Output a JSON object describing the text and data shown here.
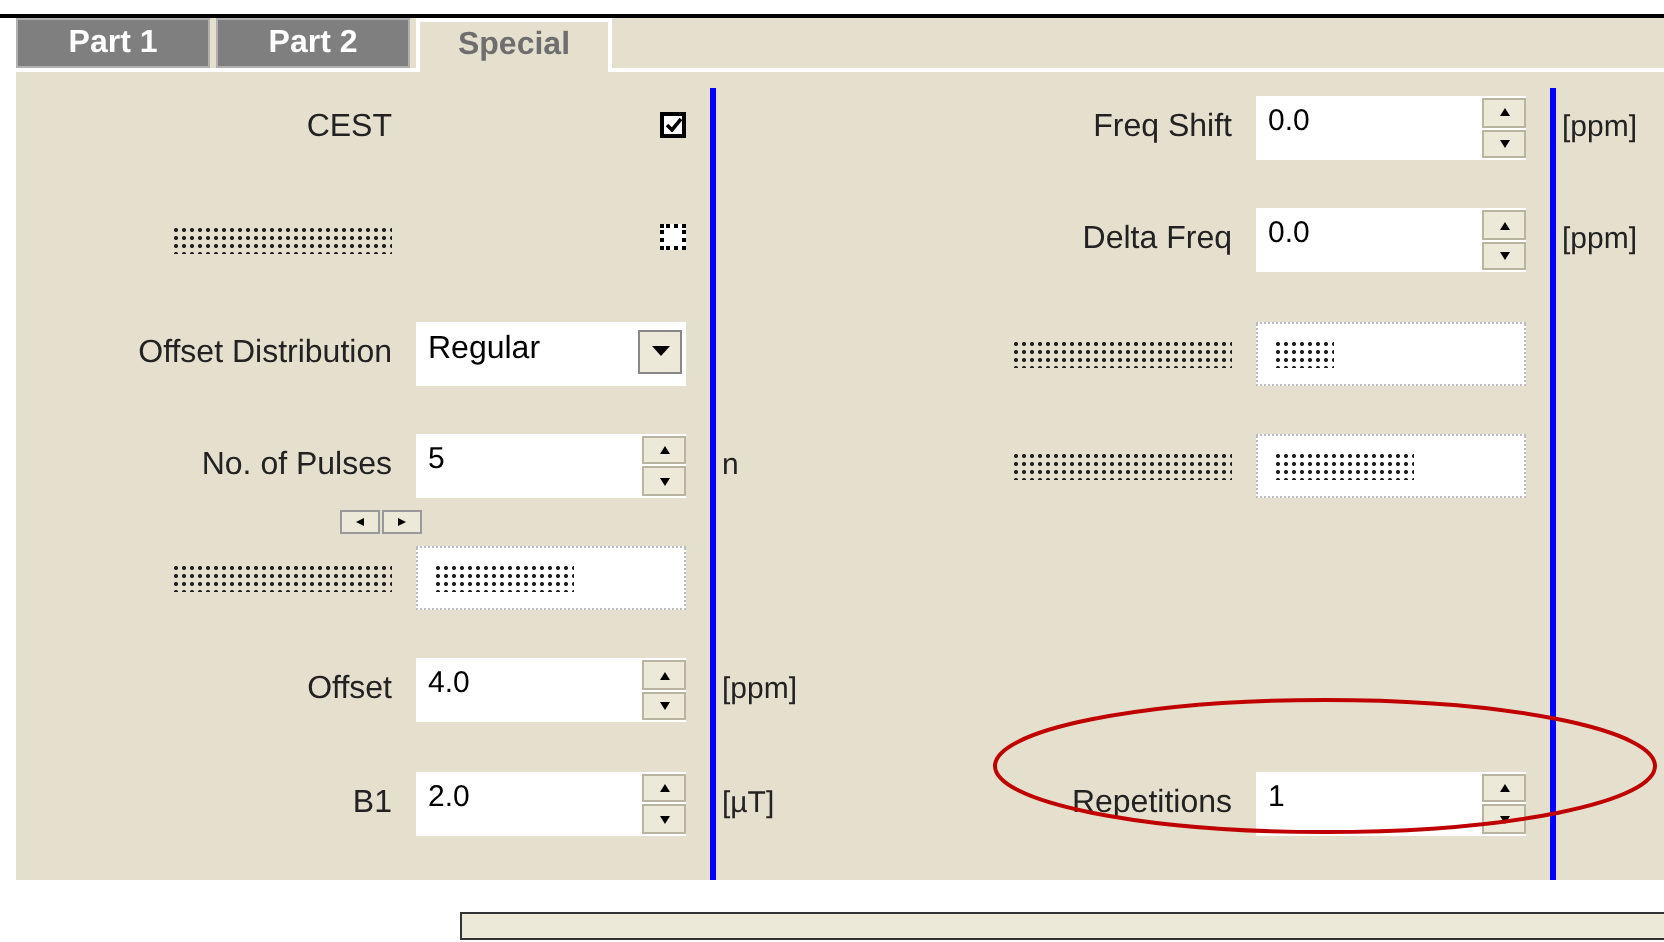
{
  "tabs": [
    {
      "label": "Part 1",
      "selected": false
    },
    {
      "label": "Part 2",
      "selected": false
    },
    {
      "label": "Special",
      "selected": true
    }
  ],
  "left": [
    {
      "kind": "checkbox",
      "label": "CEST",
      "checked": true
    },
    {
      "kind": "obscured-checkbox",
      "checked": false
    },
    {
      "kind": "dropdown",
      "label": "Offset Distribution",
      "value": "Regular"
    },
    {
      "kind": "spin",
      "label": "No. of Pulses",
      "value": "5",
      "unit": "n",
      "pager": true
    },
    {
      "kind": "obscured-dropdown"
    },
    {
      "kind": "spin",
      "label": "Offset",
      "value": "4.0",
      "unit": "[ppm]"
    },
    {
      "kind": "spin",
      "label": "B1",
      "value": "2.0",
      "unit": "[µT]"
    }
  ],
  "right": [
    {
      "kind": "spin",
      "label": "Freq Shift",
      "value": "0.0",
      "unit": "[ppm]"
    },
    {
      "kind": "spin",
      "label": "Delta Freq",
      "value": "0.0",
      "unit": "[ppm]"
    },
    {
      "kind": "obscured-spin"
    },
    {
      "kind": "obscured-dropdown"
    },
    {
      "kind": "empty"
    },
    {
      "kind": "empty"
    },
    {
      "kind": "spin",
      "label": "Repetitions",
      "value": "1",
      "highlighted": true
    }
  ]
}
